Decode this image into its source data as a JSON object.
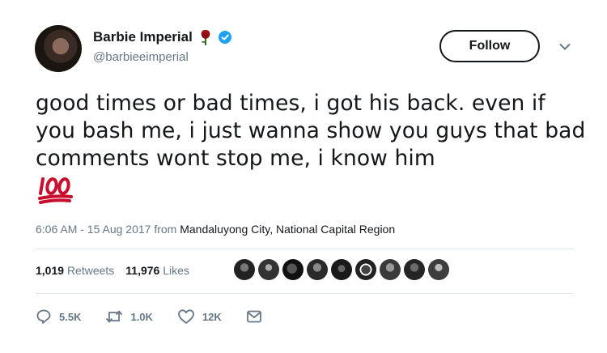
{
  "user": {
    "display_name": "Barbie Imperial",
    "handle": "@barbieeimperial",
    "badge_icons": [
      "rose-icon",
      "verified-icon"
    ]
  },
  "follow_button": {
    "label": "Follow"
  },
  "more_menu": {
    "icon": "chevron-down-icon"
  },
  "tweet": {
    "text": "good times or bad times, i got his back. even if you bash me, i just wanna show you guys that bad comments wont stop me, i know him",
    "emoji": "hundred-points-icon"
  },
  "meta": {
    "time_date": "6:06 AM - 15 Aug 2017 from ",
    "location": "Mandaluyong City, National Capital Region"
  },
  "stats": {
    "retweets_count": "1,019",
    "retweets_label": "Retweets",
    "likes_count": "11,976",
    "likes_label": "Likes",
    "liker_avatars": 9
  },
  "actions": {
    "replies": "5.5K",
    "retweets": "1.0K",
    "likes": "12K"
  },
  "colors": {
    "verified_blue": "#1da1f2",
    "secondary_text": "#657786",
    "emoji_red": "#c8102e"
  }
}
